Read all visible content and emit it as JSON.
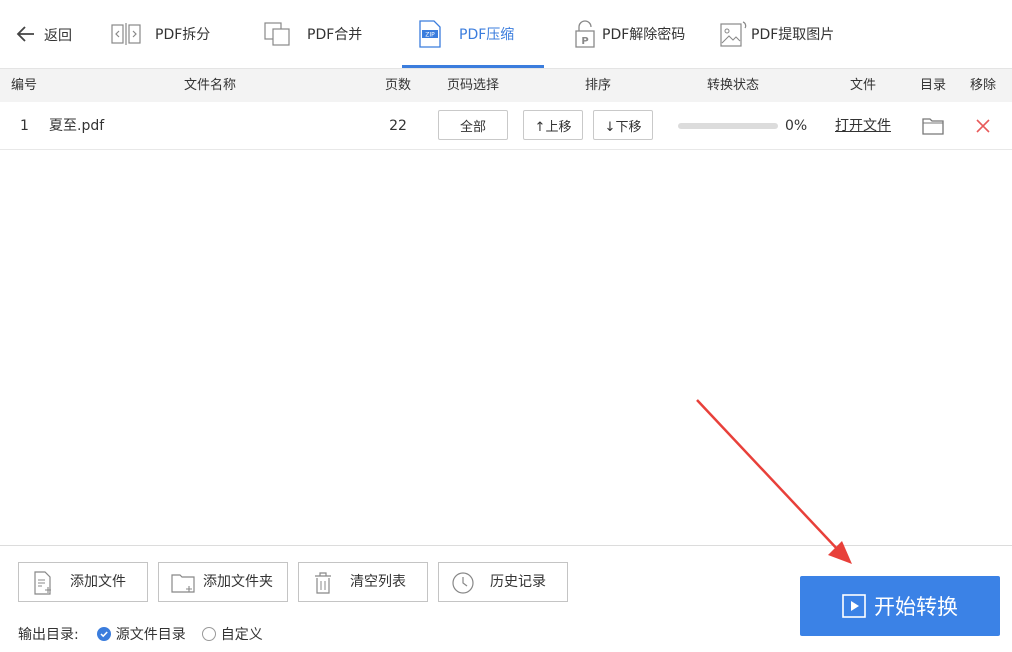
{
  "toolbar": {
    "back_label": "返回",
    "tabs": [
      {
        "label": "PDF拆分",
        "icon": "split-icon"
      },
      {
        "label": "PDF合并",
        "icon": "merge-icon"
      },
      {
        "label": "PDF压缩",
        "icon": "zip-icon",
        "active": true
      },
      {
        "label": "PDF解除密码",
        "icon": "unlock-icon"
      },
      {
        "label": "PDF提取图片",
        "icon": "image-extract-icon"
      }
    ],
    "zip_icon_text": "ZIP"
  },
  "table": {
    "headers": [
      "编号",
      "文件名称",
      "页数",
      "页码选择",
      "排序",
      "转换状态",
      "文件",
      "目录",
      "移除"
    ],
    "rows": [
      {
        "index": "1",
        "filename": "夏至.pdf",
        "pages": "22",
        "page_select": "全部",
        "move_up": "↑上移",
        "move_down": "↓下移",
        "progress_fraction": 0,
        "progress_text": "0%",
        "open_file": "打开文件"
      }
    ]
  },
  "bottom": {
    "add_file": "添加文件",
    "add_folder": "添加文件夹",
    "clear_list": "清空列表",
    "history": "历史记录",
    "output_dir_label": "输出目录:",
    "radio_source": "源文件目录",
    "radio_custom": "自定义",
    "selected_output": "源文件目录"
  },
  "start_button": "开始转换",
  "colors": {
    "accent": "#3b7ddd",
    "start_button": "#3b82e6",
    "remove_x": "#e85a5a",
    "annotation_arrow": "#e8403a"
  }
}
